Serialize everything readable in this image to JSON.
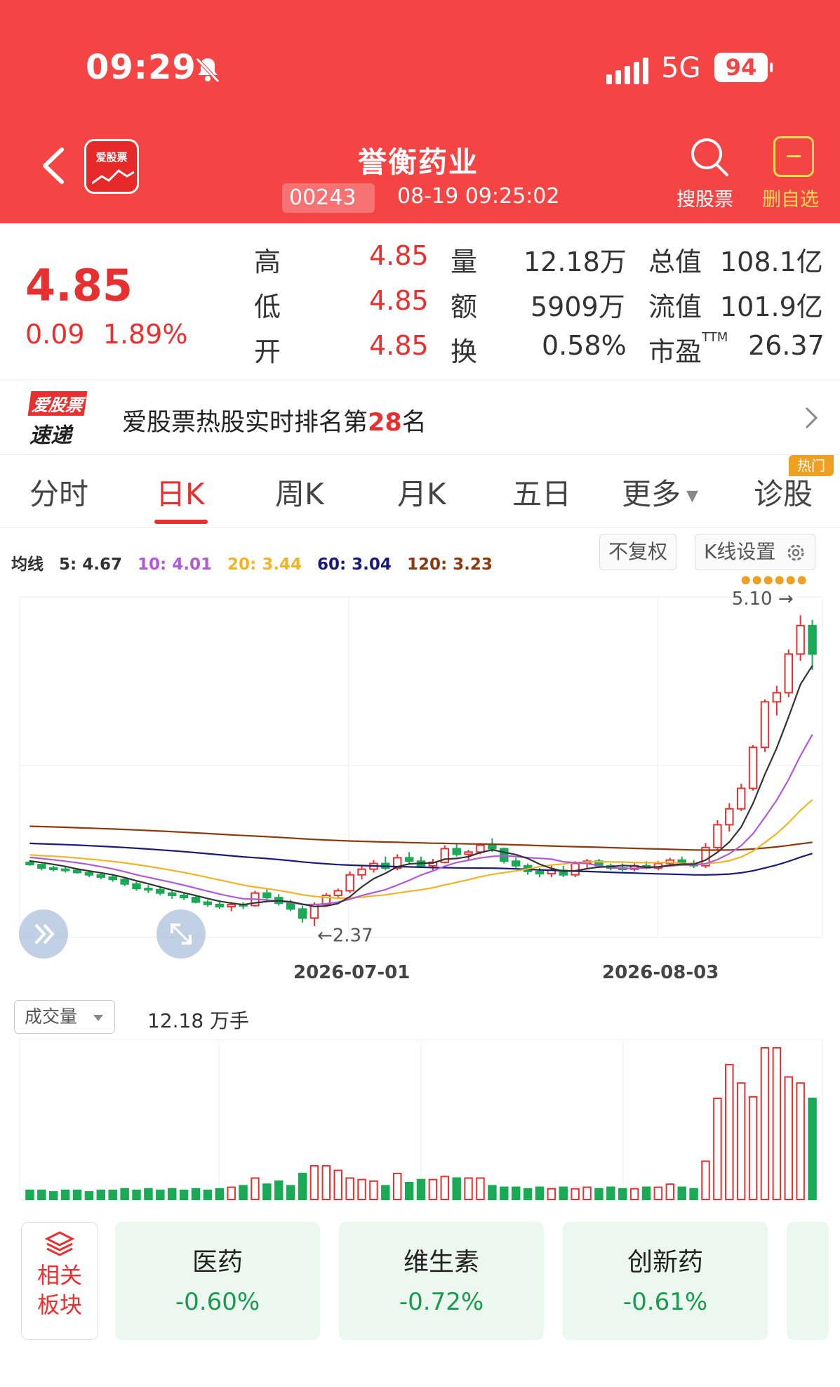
{
  "status": {
    "time": "09:29",
    "network": "5G",
    "battery": "94"
  },
  "header": {
    "stock_name": "誉衡药业",
    "code": "00243",
    "quote_time": "08-19 09:25:02",
    "logo_text": "爱股票",
    "search_label": "搜股票",
    "remove_label": "删自选"
  },
  "quote": {
    "price": "4.85",
    "change": "0.09",
    "change_pct": "1.89%",
    "high_label": "高",
    "high": "4.85",
    "low_label": "低",
    "low": "4.85",
    "open_label": "开",
    "open": "4.85",
    "vol_label": "量",
    "volume": "12.18万",
    "amt_label": "额",
    "amount": "5909万",
    "turn_label": "换",
    "turnover": "0.58%",
    "mcap_label": "总值",
    "mcap": "108.1亿",
    "float_label": "流值",
    "float_cap": "101.9亿",
    "pe_label": "市盈",
    "pe_sup": "TTM",
    "pe": "26.37"
  },
  "banner": {
    "logo_line1": "爱股票",
    "logo_line2": "速递",
    "text_prefix": "爱股票热股实时排名第",
    "rank": "28",
    "text_suffix": "名"
  },
  "tabs": [
    {
      "label": "分时"
    },
    {
      "label": "日K"
    },
    {
      "label": "周K"
    },
    {
      "label": "月K"
    },
    {
      "label": "五日"
    },
    {
      "label": "更多"
    },
    {
      "label": "诊股"
    }
  ],
  "active_tab": "日K",
  "hot_badge": "热门",
  "ma": {
    "title": "均线",
    "ma5": "5: 4.67",
    "ma10": "10: 4.01",
    "ma20": "20: 3.44",
    "ma60": "60: 3.04",
    "ma120": "120: 3.23"
  },
  "chart_buttons": {
    "adjust": "不复权",
    "settings": "K线设置"
  },
  "chart_labels": {
    "high_mark": "5.10",
    "low_mark": "2.37",
    "date1": "2026-07-01",
    "date2": "2026-08-03"
  },
  "volume": {
    "selector": "成交量",
    "value": "12.18 万手"
  },
  "colors": {
    "up": "#e83030",
    "down": "#1aaa55",
    "ma5": "#333333",
    "ma10": "#b05ad8",
    "ma20": "#f0b428",
    "ma60": "#1a1a7a",
    "ma120": "#8b3a0f",
    "header": "#f44444"
  },
  "sectors": {
    "related_label_1": "相关",
    "related_label_2": "板块",
    "items": [
      {
        "name": "医药",
        "pct": "-0.60%"
      },
      {
        "name": "维生素",
        "pct": "-0.72%"
      },
      {
        "name": "创新药",
        "pct": "-0.61%"
      }
    ]
  },
  "chart_data": {
    "type": "candlestick",
    "annotations": {
      "max": 5.1,
      "min": 2.37
    },
    "x_dates": [
      "2026-07-01",
      "2026-08-03"
    ],
    "series": [
      {
        "name": "price",
        "ohlc": [
          [
            2.93,
            2.95,
            2.9,
            2.91
          ],
          [
            2.91,
            2.92,
            2.86,
            2.88
          ],
          [
            2.88,
            2.9,
            2.85,
            2.87
          ],
          [
            2.87,
            2.89,
            2.84,
            2.86
          ],
          [
            2.86,
            2.88,
            2.83,
            2.84
          ],
          [
            2.84,
            2.86,
            2.8,
            2.82
          ],
          [
            2.82,
            2.84,
            2.78,
            2.8
          ],
          [
            2.8,
            2.82,
            2.76,
            2.78
          ],
          [
            2.78,
            2.8,
            2.72,
            2.74
          ],
          [
            2.74,
            2.76,
            2.68,
            2.7
          ],
          [
            2.7,
            2.73,
            2.66,
            2.69
          ],
          [
            2.69,
            2.71,
            2.64,
            2.66
          ],
          [
            2.66,
            2.68,
            2.61,
            2.64
          ],
          [
            2.64,
            2.66,
            2.6,
            2.62
          ],
          [
            2.62,
            2.64,
            2.57,
            2.58
          ],
          [
            2.58,
            2.6,
            2.54,
            2.56
          ],
          [
            2.56,
            2.58,
            2.52,
            2.54
          ],
          [
            2.54,
            2.58,
            2.5,
            2.56
          ],
          [
            2.56,
            2.58,
            2.52,
            2.55
          ],
          [
            2.55,
            2.68,
            2.54,
            2.66
          ],
          [
            2.66,
            2.7,
            2.6,
            2.62
          ],
          [
            2.62,
            2.65,
            2.55,
            2.57
          ],
          [
            2.57,
            2.6,
            2.5,
            2.52
          ],
          [
            2.52,
            2.55,
            2.4,
            2.44
          ],
          [
            2.44,
            2.58,
            2.37,
            2.56
          ],
          [
            2.56,
            2.66,
            2.54,
            2.64
          ],
          [
            2.64,
            2.7,
            2.62,
            2.68
          ],
          [
            2.68,
            2.85,
            2.66,
            2.82
          ],
          [
            2.82,
            2.9,
            2.78,
            2.87
          ],
          [
            2.87,
            2.95,
            2.84,
            2.92
          ],
          [
            2.92,
            2.98,
            2.86,
            2.88
          ],
          [
            2.88,
            3.0,
            2.86,
            2.97
          ],
          [
            2.97,
            3.02,
            2.92,
            2.94
          ],
          [
            2.94,
            2.98,
            2.88,
            2.9
          ],
          [
            2.9,
            2.96,
            2.86,
            2.93
          ],
          [
            2.93,
            3.08,
            2.92,
            3.05
          ],
          [
            3.05,
            3.1,
            2.98,
            3.0
          ],
          [
            3.0,
            3.04,
            2.95,
            3.02
          ],
          [
            3.02,
            3.1,
            3.0,
            3.08
          ],
          [
            3.08,
            3.14,
            3.02,
            3.05
          ],
          [
            3.05,
            3.06,
            2.92,
            2.94
          ],
          [
            2.94,
            2.97,
            2.88,
            2.9
          ],
          [
            2.9,
            2.92,
            2.82,
            2.85
          ],
          [
            2.85,
            2.88,
            2.8,
            2.83
          ],
          [
            2.83,
            2.9,
            2.8,
            2.86
          ],
          [
            2.86,
            2.9,
            2.8,
            2.82
          ],
          [
            2.82,
            2.94,
            2.8,
            2.92
          ],
          [
            2.92,
            2.96,
            2.88,
            2.94
          ],
          [
            2.94,
            2.96,
            2.88,
            2.9
          ],
          [
            2.9,
            2.92,
            2.86,
            2.88
          ],
          [
            2.88,
            2.92,
            2.85,
            2.87
          ],
          [
            2.87,
            2.92,
            2.85,
            2.9
          ],
          [
            2.9,
            2.94,
            2.87,
            2.88
          ],
          [
            2.88,
            2.94,
            2.86,
            2.92
          ],
          [
            2.92,
            2.97,
            2.9,
            2.95
          ],
          [
            2.95,
            2.98,
            2.9,
            2.92
          ],
          [
            2.92,
            2.95,
            2.88,
            2.9
          ],
          [
            2.9,
            3.1,
            2.88,
            3.06
          ],
          [
            3.06,
            3.3,
            3.04,
            3.26
          ],
          [
            3.26,
            3.45,
            3.2,
            3.4
          ],
          [
            3.4,
            3.62,
            3.38,
            3.58
          ],
          [
            3.58,
            3.96,
            3.56,
            3.94
          ],
          [
            3.94,
            4.36,
            3.9,
            4.34
          ],
          [
            4.34,
            4.48,
            4.22,
            4.42
          ],
          [
            4.42,
            4.8,
            4.38,
            4.76
          ],
          [
            4.76,
            5.1,
            4.7,
            5.01
          ],
          [
            5.01,
            5.06,
            4.62,
            4.76
          ]
        ]
      }
    ],
    "volume": [
      6,
      6,
      5,
      6,
      6,
      5,
      6,
      6,
      7,
      6,
      7,
      6,
      7,
      6,
      7,
      6,
      7,
      8,
      9,
      14,
      10,
      12,
      9,
      17,
      22,
      22,
      19,
      14,
      13,
      12,
      9,
      17,
      11,
      13,
      13,
      15,
      14,
      14,
      14,
      9,
      8,
      8,
      7,
      8,
      7,
      8,
      7,
      8,
      7,
      8,
      7,
      7,
      8,
      8,
      10,
      8,
      7,
      25,
      66,
      88,
      76,
      67,
      99,
      99,
      80,
      76,
      66
    ],
    "volume_unit": "万手",
    "ma_lines": [
      "MA5",
      "MA10",
      "MA20",
      "MA60",
      "MA120"
    ]
  }
}
